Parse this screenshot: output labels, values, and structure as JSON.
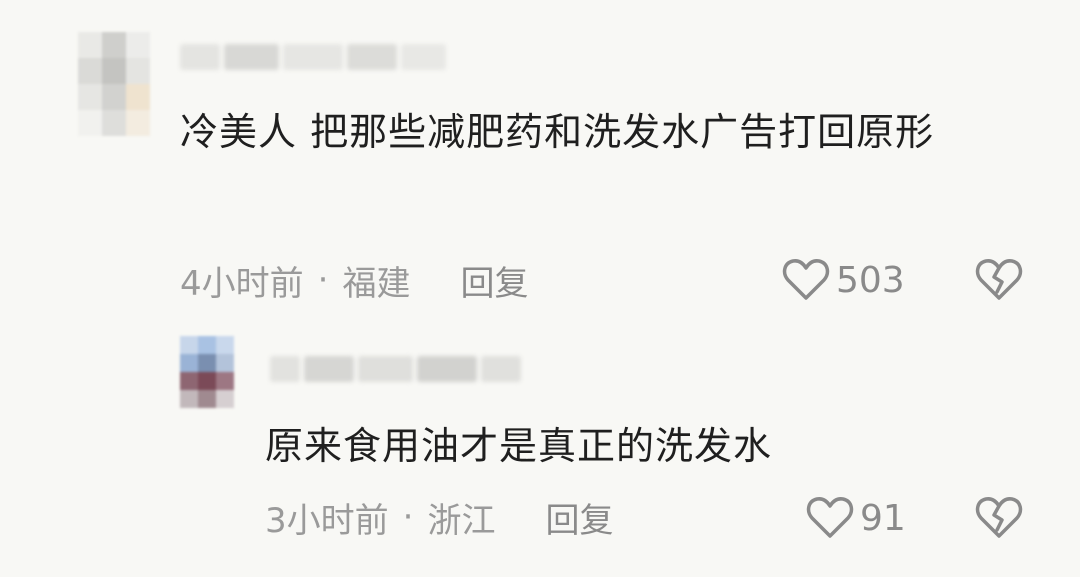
{
  "comments": [
    {
      "content": "冷美人 把那些减肥药和洗发水广告打回原形",
      "time": "4小时前",
      "separator": "·",
      "location": "福建",
      "reply_label": "回复",
      "likes": "503"
    },
    {
      "content": "原来食用油才是真正的洗发水",
      "time": "3小时前",
      "separator": "·",
      "location": "浙江",
      "reply_label": "回复",
      "likes": "91"
    }
  ],
  "icons": {
    "like": "heart-outline-icon",
    "dislike": "broken-heart-icon"
  },
  "colors": {
    "background": "#f8f8f5",
    "text": "#1f1f1f",
    "meta": "#9a9a9a",
    "icon": "#8a8a8a"
  }
}
